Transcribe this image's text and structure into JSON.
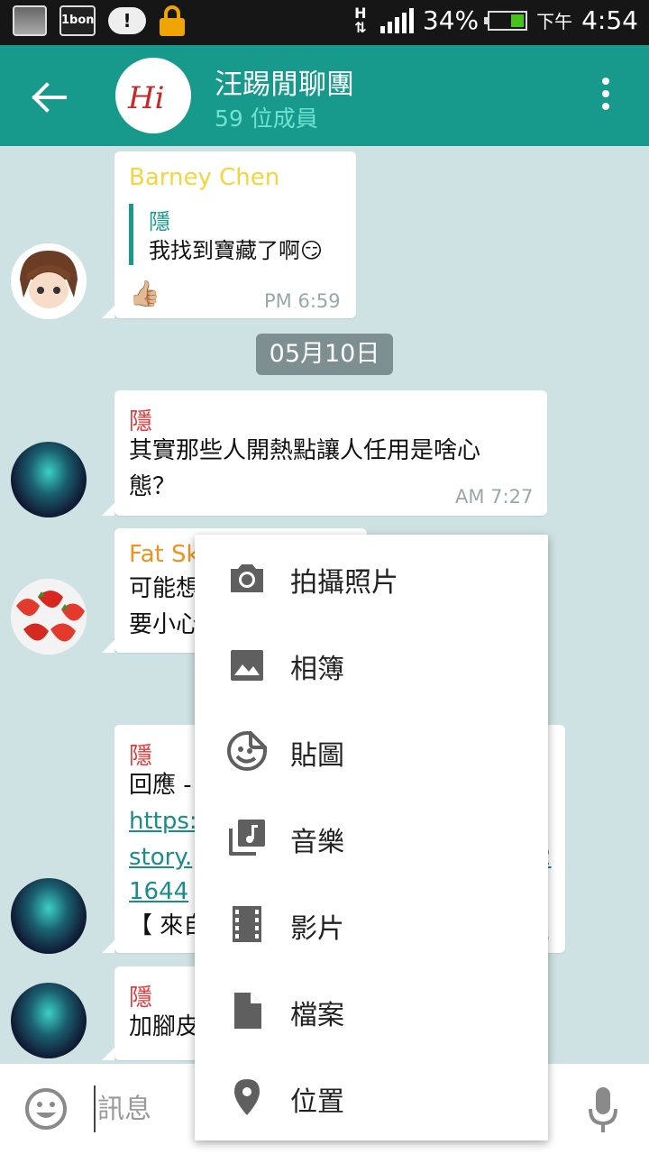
{
  "statusbar": {
    "network": "H",
    "battery": "34%",
    "ampm": "下午",
    "time": "4:54",
    "app_badge": "1bon"
  },
  "header": {
    "title": "汪踢閒聊團",
    "subtitle": "59 位成員",
    "avatar_text": "Hi"
  },
  "colors": {
    "header": "#179a8c",
    "subtitle": "#6fe3cf",
    "link": "#1a8c8c",
    "name_yellow": "#f4d53f",
    "name_red": "#e5393c",
    "name_orange": "#f0921d"
  },
  "messages": [
    {
      "sender": "Barney Chen",
      "quote_name": "隱",
      "quote_text": "我找到寶藏了啊😏",
      "body": "👍🏼",
      "time": "PM 6:59"
    },
    {
      "sender": "隱",
      "body_line1": "其實那些人開熱點讓人任用是啥心",
      "body_line2": "態？",
      "time": "AM 7:27"
    },
    {
      "sender": "Fat Sk",
      "body_line1": "可能想",
      "body_line2": "要小心"
    },
    {
      "sender": "隱",
      "body_line1": "回應 -",
      "link_line1": "https:",
      "link_line2": "story.",
      "link_line2_end": "2",
      "link_line3": "1644",
      "body_line5": "【 來自",
      "time_tail": "3"
    },
    {
      "sender": "隱",
      "body_line1": "加腳皮"
    }
  ],
  "date_divider": "05月10日",
  "input": {
    "placeholder": "訊息"
  },
  "attach_menu": [
    {
      "label": "拍攝照片",
      "icon": "camera-icon"
    },
    {
      "label": "相簿",
      "icon": "image-icon"
    },
    {
      "label": "貼圖",
      "icon": "sticker-icon"
    },
    {
      "label": "音樂",
      "icon": "music-library-icon"
    },
    {
      "label": "影片",
      "icon": "film-icon"
    },
    {
      "label": "檔案",
      "icon": "file-icon"
    },
    {
      "label": "位置",
      "icon": "location-pin-icon"
    }
  ]
}
